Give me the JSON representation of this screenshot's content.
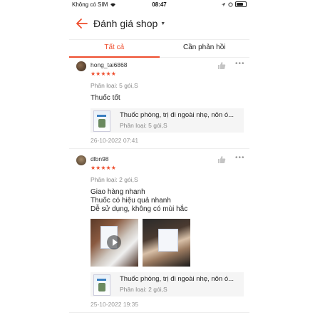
{
  "status_bar": {
    "carrier": "Không có SIM",
    "time": "08:47"
  },
  "header": {
    "title": "Đánh giá shop"
  },
  "tabs": [
    {
      "label": "Tất cả",
      "active": true
    },
    {
      "label": "Cần phản hồi",
      "active": false
    }
  ],
  "reviews": [
    {
      "username": "hong_tai6868",
      "rating": 5,
      "stars": "★★★★★",
      "variant": "Phân loại: 5 gói,S",
      "content": [
        "Thuốc tốt"
      ],
      "product": {
        "name": "Thuốc phòng, trị đi ngoài nhẹ, nôn ó...",
        "variant": "Phân loại: 5 gói,S"
      },
      "date": "26-10-2022 07:41"
    },
    {
      "username": "dlbn98",
      "rating": 5,
      "stars": "★★★★★",
      "variant": "Phân loại: 2 gói,S",
      "content": [
        "Giao hàng nhanh",
        "Thuốc có hiệu quả nhanh",
        "Dễ sử dụng, không có mùi hắc"
      ],
      "media": [
        "video",
        "photo"
      ],
      "product": {
        "name": "Thuốc phòng, trị đi ngoài nhẹ, nôn ó...",
        "variant": "Phân loại: 2 gói,S"
      },
      "date": "25-10-2022 19:35"
    }
  ],
  "colors": {
    "accent": "#ee4d2d"
  }
}
